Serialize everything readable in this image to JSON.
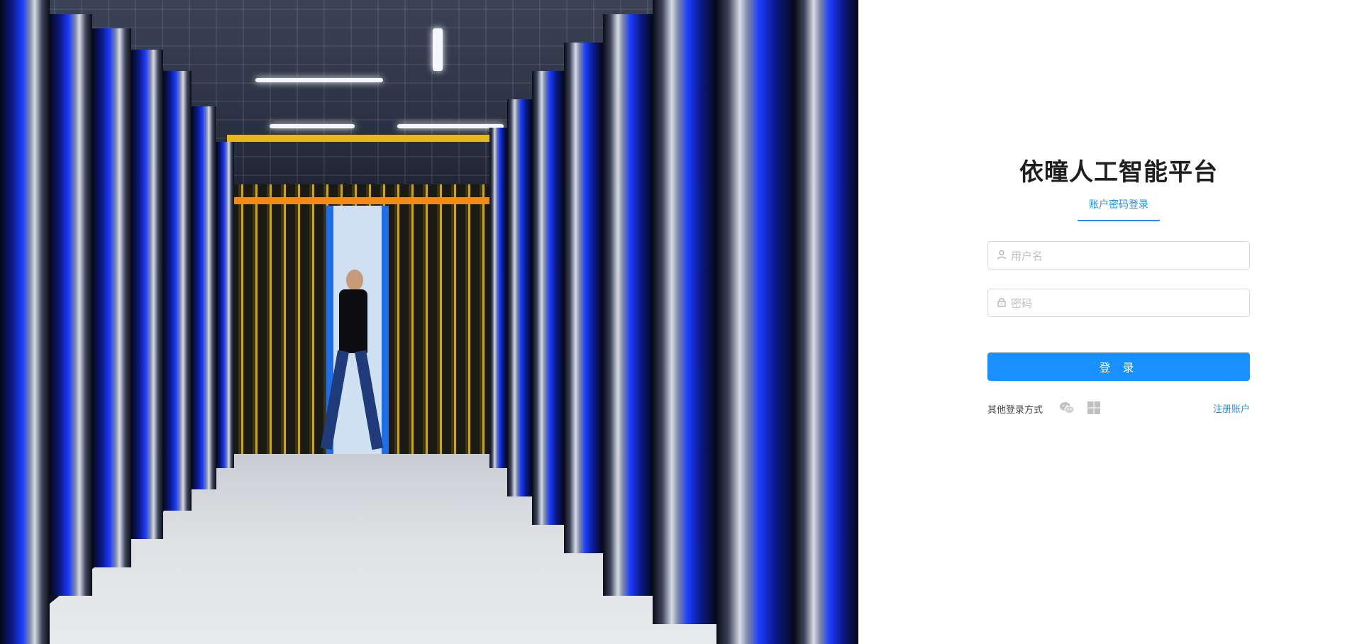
{
  "hero": {
    "description_icon": "data-center-photo"
  },
  "login": {
    "title": "依曈人工智能平台",
    "tabs": [
      {
        "label": "账户密码登录",
        "active": true
      }
    ],
    "username": {
      "value": "",
      "placeholder": "用户名",
      "icon": "user-icon"
    },
    "password": {
      "value": "",
      "placeholder": "密码",
      "icon": "lock-icon"
    },
    "submit_label": "登 录",
    "other_methods_label": "其他登录方式",
    "other_method_icons": [
      "wechat-icon",
      "windows-icon"
    ],
    "register_label": "注册账户"
  },
  "colors": {
    "accent": "#1890ff",
    "title": "#1f1f1f",
    "placeholder": "#bfbfbf",
    "icon_gray": "#c0c0c0",
    "border": "#d9d9d9"
  }
}
